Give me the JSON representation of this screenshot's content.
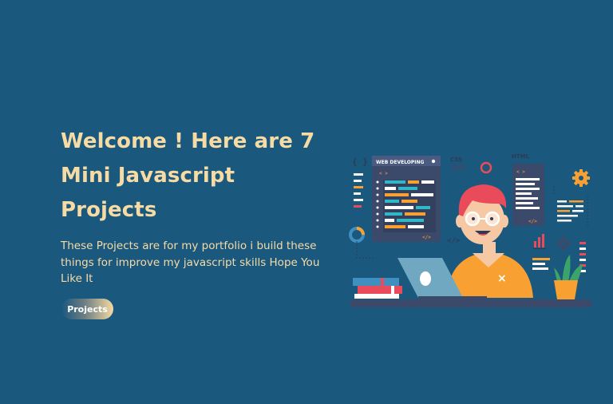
{
  "hero": {
    "title": "Welcome ! Here are 7 Mini Javascript Projects",
    "description": "These Projects are for my portfolio i build these things for improve my javascript skills Hope You Like It",
    "button_label": "Projects"
  },
  "illustration": {
    "window_label": "WEB DEVELOPING",
    "code_tag": "< >",
    "code_tag_close": "</>",
    "css_label": "CSS",
    "html_label": "HTML",
    "braces_label": "{ }",
    "slash_tag": "</>",
    "close_mark": "×"
  },
  "colors": {
    "background": "#1b587e",
    "heading": "#f7dba4",
    "accent_orange": "#f8a132",
    "panel": "#3b4a6b"
  }
}
